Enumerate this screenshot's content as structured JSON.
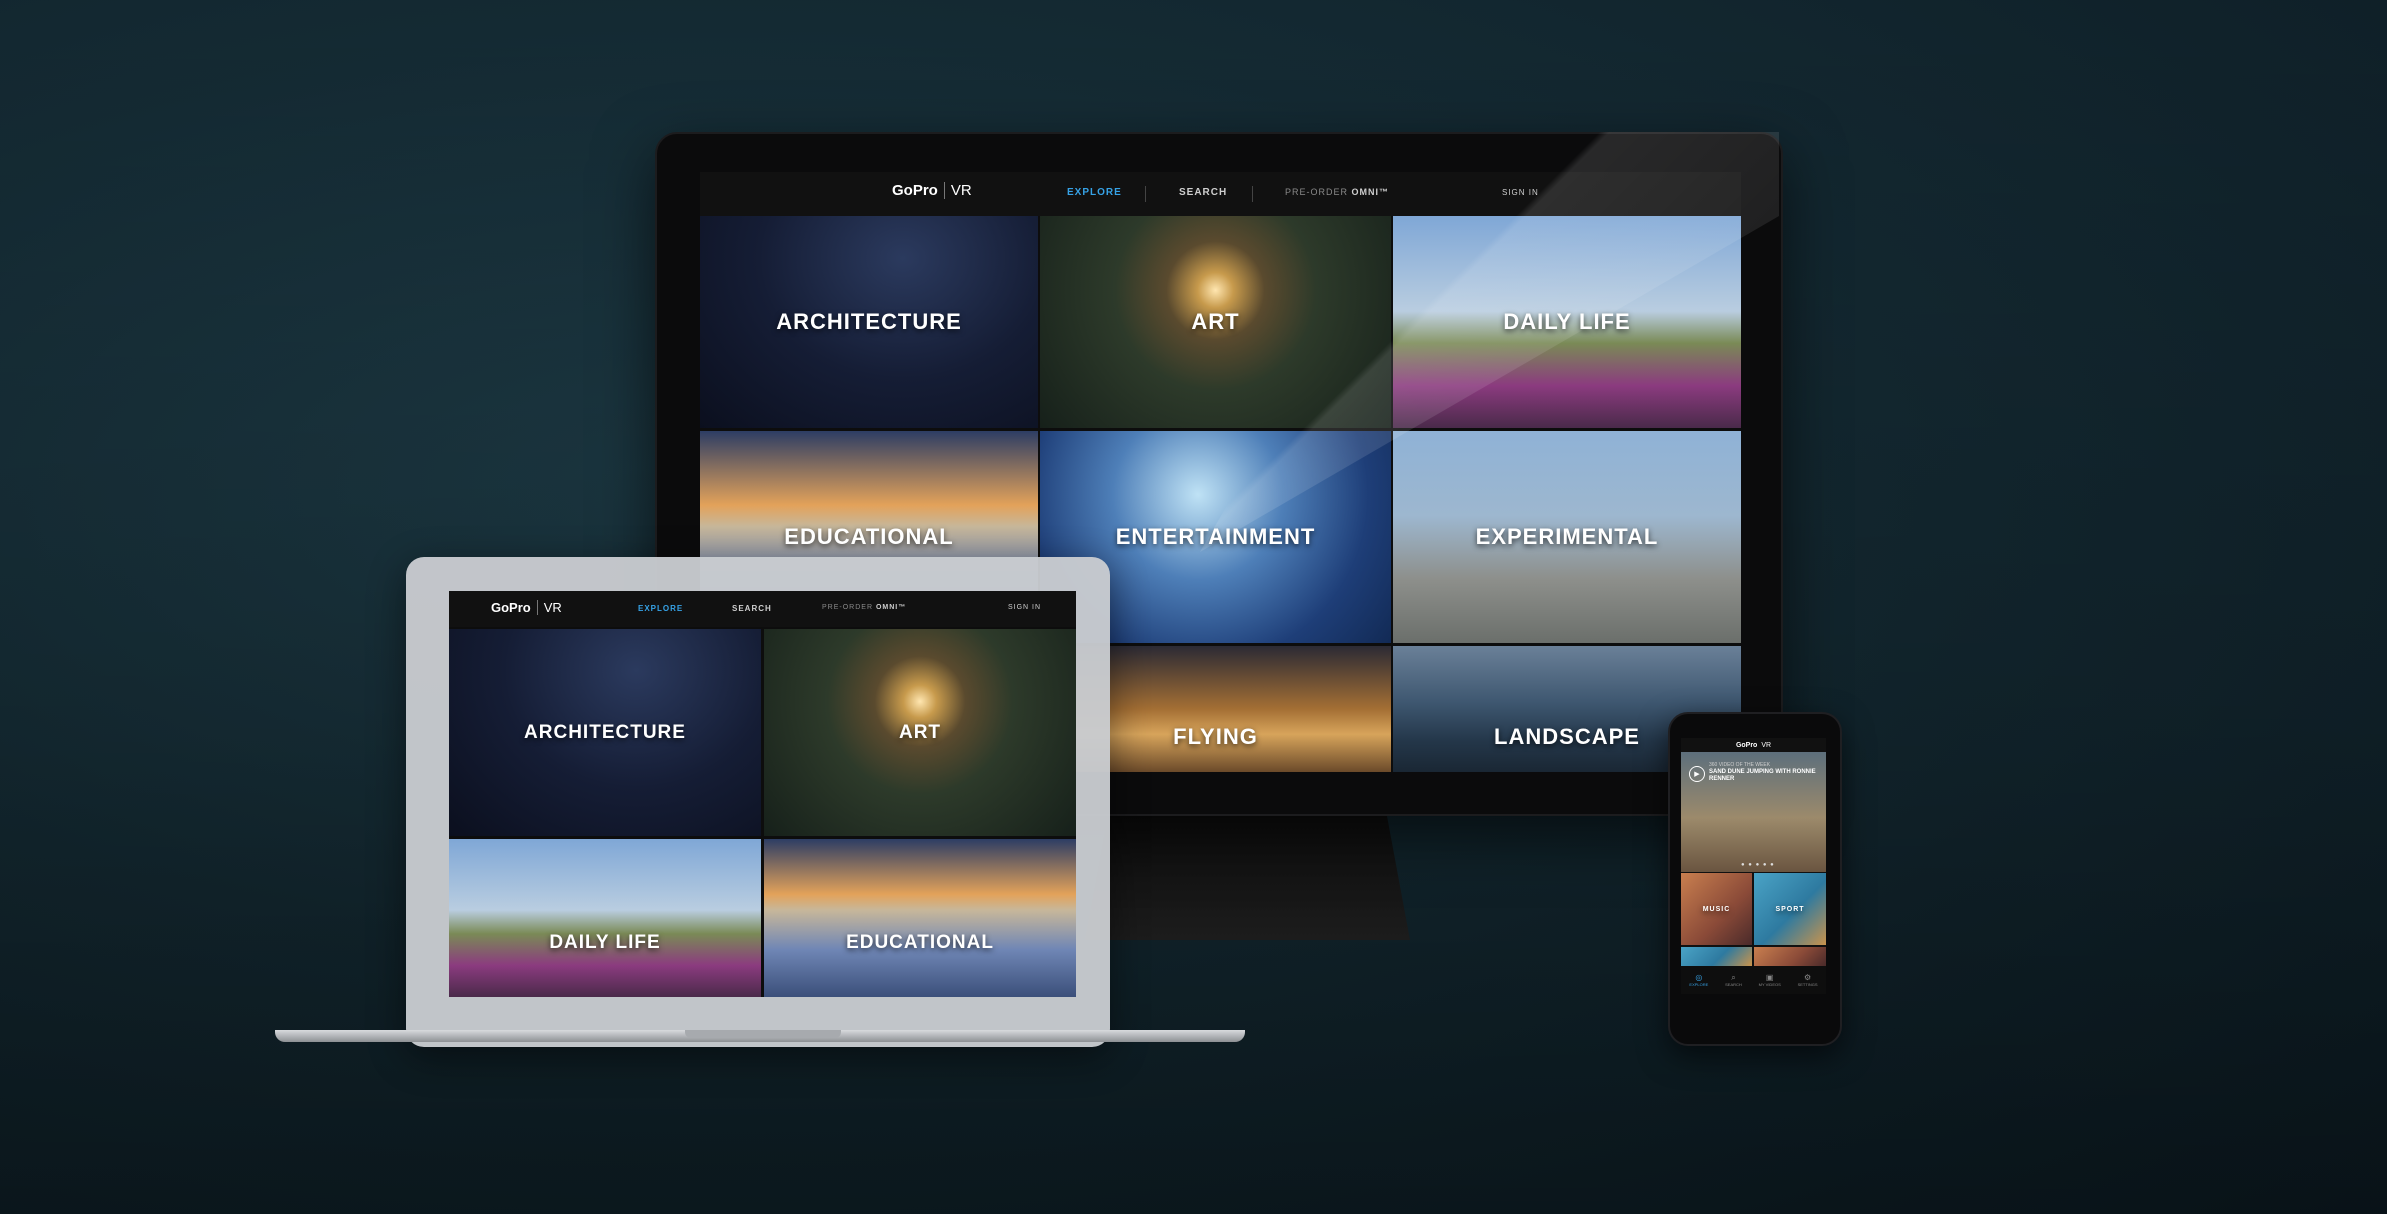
{
  "brand": {
    "logo": "GoPro",
    "logo_sub": "VR"
  },
  "nav": {
    "explore": "EXPLORE",
    "search": "SEARCH",
    "preorder_prefix": "PRE-ORDER",
    "preorder_product": "OMNI™",
    "signin": "SIGN IN"
  },
  "desktop_tiles": [
    {
      "label": "ARCHITECTURE"
    },
    {
      "label": "ART"
    },
    {
      "label": "DAILY LIFE"
    },
    {
      "label": "EDUCATIONAL"
    },
    {
      "label": "ENTERTAINMENT"
    },
    {
      "label": "EXPERIMENTAL"
    },
    {
      "label": "FLYING"
    },
    {
      "label": "LANDSCAPE"
    }
  ],
  "laptop_tiles": [
    {
      "label": "ARCHITECTURE"
    },
    {
      "label": "ART"
    },
    {
      "label": "DAILY LIFE"
    },
    {
      "label": "EDUCATIONAL"
    }
  ],
  "phone": {
    "hero_small": "360 VIDEO OF THE WEEK",
    "hero_title": "SAND DUNE JUMPING WITH RONNIE RENNER",
    "hero_dots": "● ● ● ● ●",
    "tiles": [
      {
        "label": "MUSIC"
      },
      {
        "label": "SPORT"
      }
    ],
    "tabs": [
      {
        "label": "EXPLORE",
        "icon": "compass-icon"
      },
      {
        "label": "SEARCH",
        "icon": "search-icon"
      },
      {
        "label": "MY VIDEOS",
        "icon": "video-icon"
      },
      {
        "label": "SETTINGS",
        "icon": "gear-icon"
      }
    ]
  },
  "colors": {
    "accent": "#36a2e6",
    "nav_bg": "#111111"
  }
}
